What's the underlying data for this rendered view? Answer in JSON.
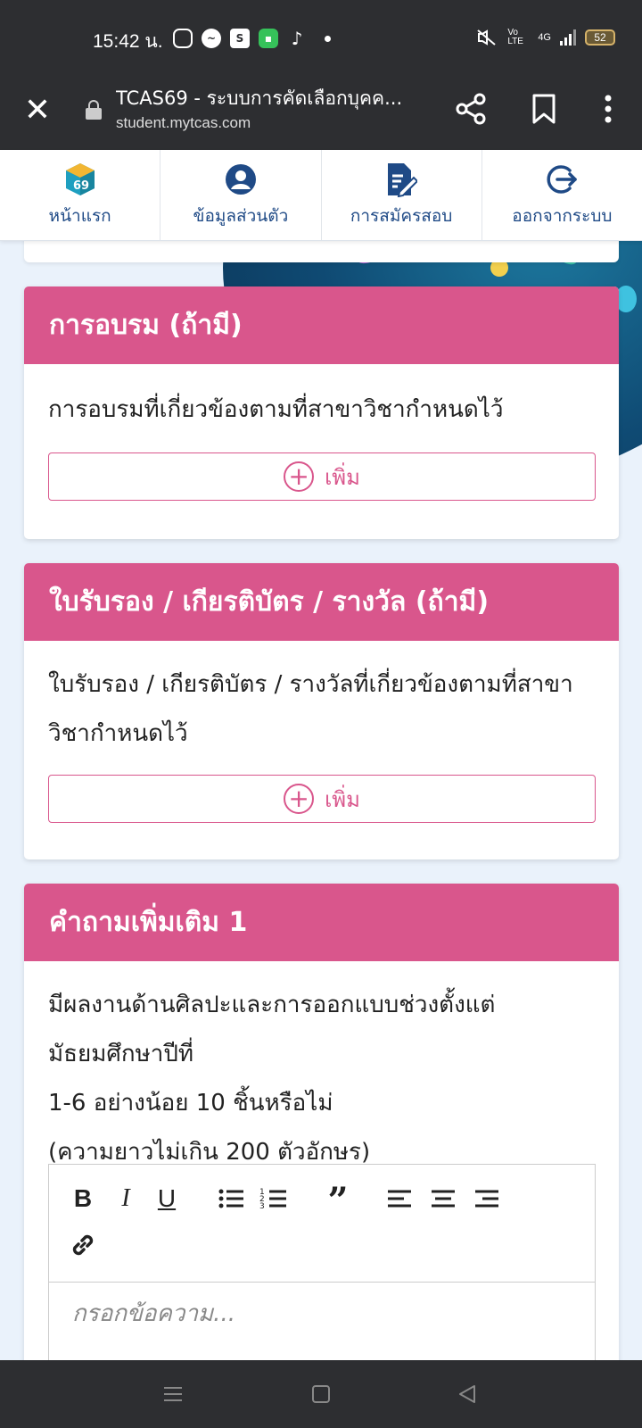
{
  "status_bar": {
    "time": "15:42 น.",
    "network": "4G",
    "volte": "Vo LTE",
    "battery": "52"
  },
  "browser": {
    "title": "TCAS69 - ระบบการคัดเลือกบุคค...",
    "url": "student.mytcas.com"
  },
  "nav": {
    "items": [
      {
        "label": "หน้าแรก",
        "icon": "tcas-69-logo-icon"
      },
      {
        "label": "ข้อมูลส่วนตัว",
        "icon": "user-circle-icon"
      },
      {
        "label": "การสมัครสอบ",
        "icon": "document-edit-icon"
      },
      {
        "label": "ออกจากระบบ",
        "icon": "logout-icon"
      }
    ],
    "logo_text": "69"
  },
  "sections": {
    "training": {
      "title": "การอบรม (ถ้ามี)",
      "description": "การอบรมที่เกี่ยวข้องตามที่สาขาวิชากำหนดไว้",
      "add_label": "เพิ่ม"
    },
    "certificates": {
      "title": "ใบรับรอง / เกียรติบัตร / รางวัล (ถ้ามี)",
      "description_line1": "ใบรับรอง / เกียรติบัตร / รางวัลที่เกี่ยวข้องตามที่สาขา",
      "description_line2": "วิชากำหนดไว้",
      "add_label": "เพิ่ม"
    },
    "question1": {
      "title": "คำถามเพิ่มเติม 1",
      "question_line1": "มีผลงานด้านศิลปะและการออกแบบช่วงตั้งแต่มัธยมศึกษาปีที่",
      "question_line2": "1-6 อย่างน้อย 10 ชิ้นหรือไม่",
      "limit": "(ความยาวไม่เกิน 200 ตัวอักษร)",
      "placeholder": "กรอกข้อความ..."
    }
  },
  "colors": {
    "accent": "#d9568c",
    "nav_text": "#1f4a86",
    "system_bar": "#2d2e31"
  }
}
